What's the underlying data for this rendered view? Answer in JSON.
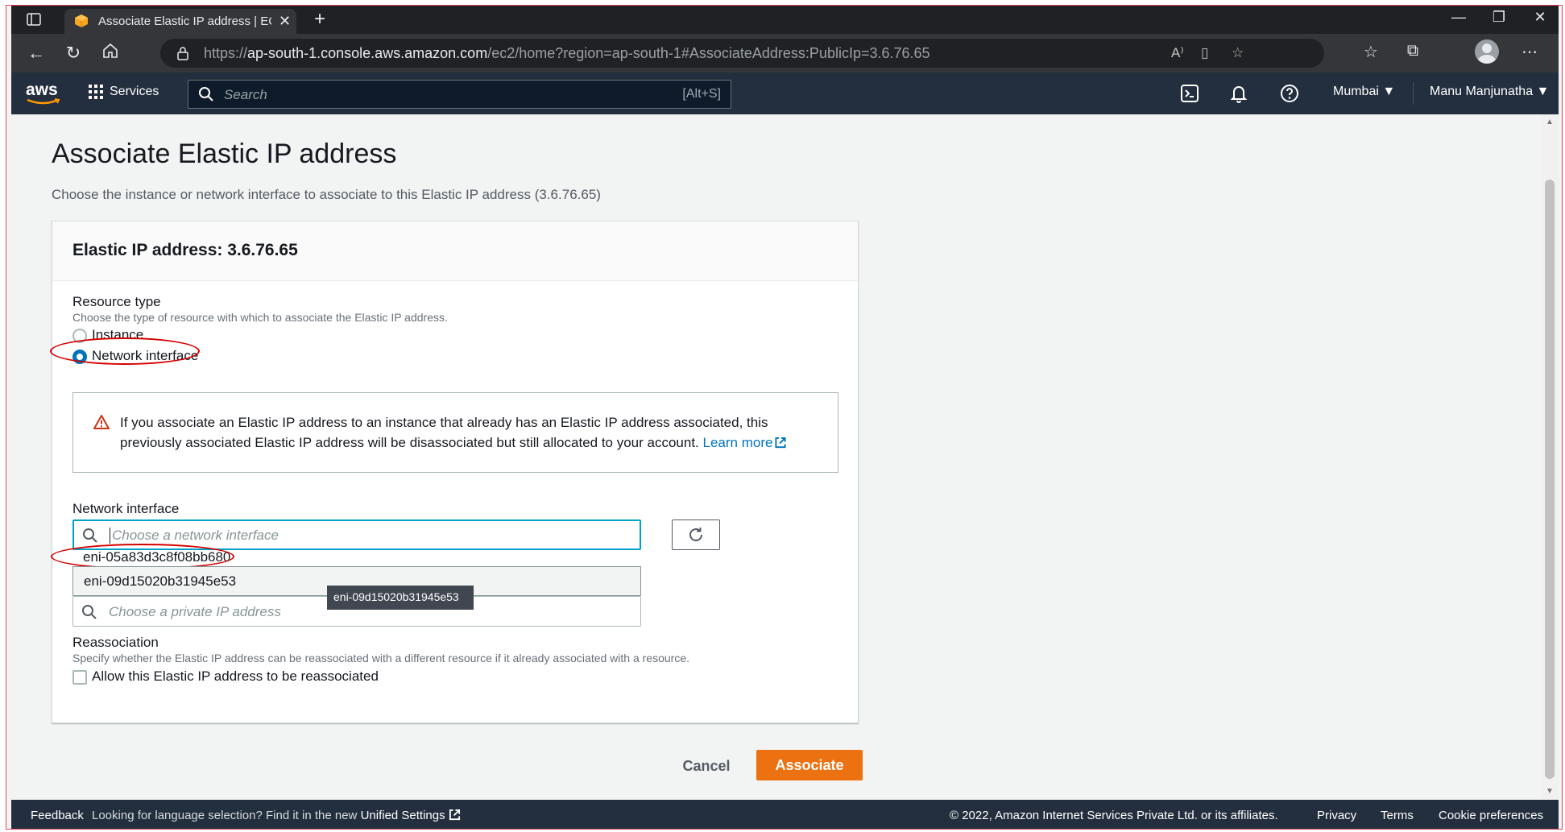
{
  "browser": {
    "tab_title": "Associate Elastic IP address | EC2",
    "url_scheme": "https://",
    "url_host": "ap-south-1.console.aws.amazon.com",
    "url_path": "/ec2/home?region=ap-south-1#AssociateAddress:PublicIp=3.6.76.65"
  },
  "aws_nav": {
    "logo": "aws",
    "services_label": "Services",
    "search_placeholder": "Search",
    "search_shortcut": "[Alt+S]",
    "region": "Mumbai",
    "user": "Manu Manjunatha"
  },
  "page": {
    "title": "Associate Elastic IP address",
    "description": "Choose the instance or network interface to associate to this Elastic IP address (3.6.76.65)"
  },
  "panel": {
    "title": "Elastic IP address: 3.6.76.65",
    "resource_type": {
      "label": "Resource type",
      "hint": "Choose the type of resource with which to associate the Elastic IP address.",
      "options": [
        "Instance",
        "Network interface"
      ],
      "selected": "Network interface"
    },
    "alert": {
      "text": "If you associate an Elastic IP address to an instance that already has an Elastic IP address associated, this previously associated Elastic IP address will be disassociated but still allocated to your account.",
      "link": "Learn more"
    },
    "network_interface": {
      "label": "Network interface",
      "placeholder": "Choose a network interface",
      "options": [
        "eni-05a83d3c8f08bb680",
        "eni-09d15020b31945e53"
      ],
      "tooltip": "eni-09d15020b31945e53"
    },
    "private_ip": {
      "placeholder": "Choose a private IP address"
    },
    "reassociation": {
      "label": "Reassociation",
      "hint": "Specify whether the Elastic IP address can be reassociated with a different resource if it already associated with a resource.",
      "checkbox_label": "Allow this Elastic IP address to be reassociated"
    }
  },
  "actions": {
    "cancel": "Cancel",
    "associate": "Associate"
  },
  "footer": {
    "feedback": "Feedback",
    "language_text": "Looking for language selection? Find it in the new",
    "unified_settings": "Unified Settings",
    "copyright": "© 2022, Amazon Internet Services Private Ltd. or its affiliates.",
    "privacy": "Privacy",
    "terms": "Terms",
    "cookie": "Cookie preferences"
  },
  "colors": {
    "aws_nav": "#232f3e",
    "primary_button": "#ec7211",
    "link": "#0073bb",
    "annotation": "#d50000"
  }
}
